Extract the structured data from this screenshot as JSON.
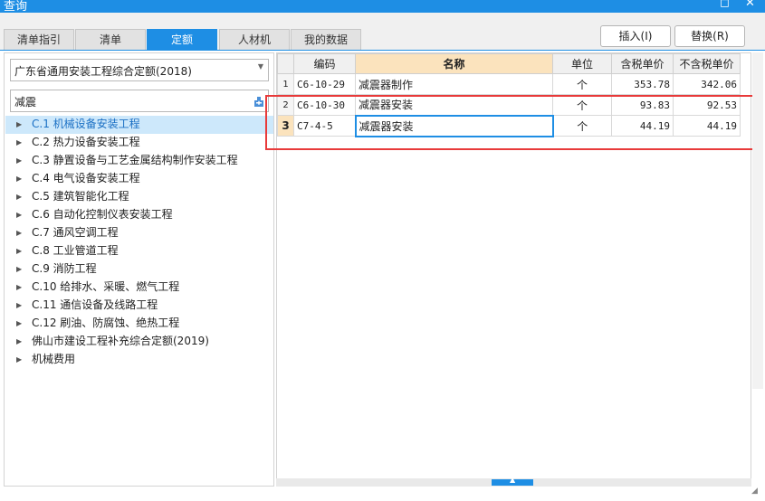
{
  "window": {
    "title": "查询",
    "maximize_glyph": "◻",
    "close_glyph": "✕"
  },
  "tabs": [
    {
      "label": "清单指引",
      "active": false
    },
    {
      "label": "清单",
      "active": false
    },
    {
      "label": "定额",
      "active": true
    },
    {
      "label": "人材机",
      "active": false
    },
    {
      "label": "我的数据",
      "active": false
    }
  ],
  "actions": {
    "insert_label": "插入(I)",
    "replace_label": "替换(R)"
  },
  "left": {
    "quota_library": "广东省通用安装工程综合定额(2018)",
    "search_value": "减震",
    "tree": [
      {
        "label": "C.1 机械设备安装工程",
        "selected": true
      },
      {
        "label": "C.2 热力设备安装工程"
      },
      {
        "label": "C.3 静置设备与工艺金属结构制作安装工程"
      },
      {
        "label": "C.4 电气设备安装工程"
      },
      {
        "label": "C.5 建筑智能化工程"
      },
      {
        "label": "C.6 自动化控制仪表安装工程"
      },
      {
        "label": "C.7 通风空调工程"
      },
      {
        "label": "C.8 工业管道工程"
      },
      {
        "label": "C.9 消防工程"
      },
      {
        "label": "C.10 给排水、采暖、燃气工程"
      },
      {
        "label": "C.11 通信设备及线路工程"
      },
      {
        "label": "C.12 刷油、防腐蚀、绝热工程"
      },
      {
        "label": "佛山市建设工程补充综合定额(2019)"
      },
      {
        "label": "机械费用"
      }
    ]
  },
  "grid": {
    "headers": {
      "code": "编码",
      "name": "名称",
      "unit": "单位",
      "price_tax": "含税单价",
      "price_notax": "不含税单价"
    },
    "rows": [
      {
        "no": "1",
        "code": "C6-10-29",
        "name": "减震器制作",
        "unit": "个",
        "price_tax": "353.78",
        "price_notax": "342.06"
      },
      {
        "no": "2",
        "code": "C6-10-30",
        "name": "减震器安装",
        "unit": "个",
        "price_tax": "93.83",
        "price_notax": "92.53"
      },
      {
        "no": "3",
        "code": "C7-4-5",
        "name": "减震器安装",
        "unit": "个",
        "price_tax": "44.19",
        "price_notax": "44.19"
      }
    ]
  },
  "colors": {
    "accent": "#1e8ee4",
    "highlight": "#e83a3a",
    "header_selected": "#fbe3bd"
  }
}
